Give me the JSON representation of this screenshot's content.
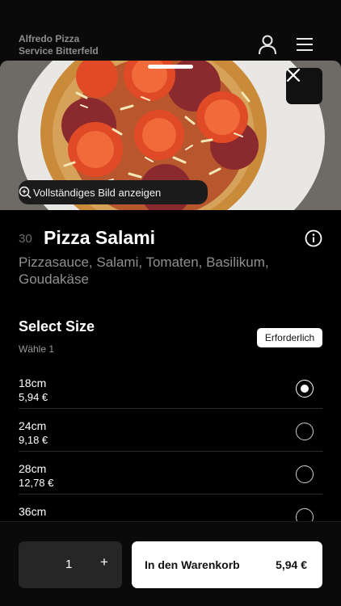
{
  "header": {
    "brand_line1": "Alfredo Pizza",
    "brand_line2": "Service Bitterfeld",
    "icons": [
      "user-icon",
      "menu-icon"
    ]
  },
  "image": {
    "view_full_label": "Vollständiges Bild anzeigen",
    "icons": [
      "close-icon",
      "zoom-icon"
    ]
  },
  "dish": {
    "number": "30",
    "name": "Pizza Salami",
    "description": "Pizzasauce, Salami, Tomaten, Basilikum, Goudakäse"
  },
  "size_section": {
    "title": "Select Size",
    "subtitle": "Wähle 1",
    "badge": "Erforderlich",
    "options": [
      {
        "name": "18cm",
        "price": "5,94 €",
        "selected": true
      },
      {
        "name": "24cm",
        "price": "9,18 €",
        "selected": false
      },
      {
        "name": "28cm",
        "price": "12,78 €",
        "selected": false
      },
      {
        "name": "36cm",
        "price": "",
        "selected": false
      }
    ]
  },
  "footer": {
    "quantity": "1",
    "plus_label": "+",
    "cart_label": "In den Warenkorb",
    "cart_price": "5,94 €"
  },
  "colors": {
    "background": "#000000",
    "accent": "#ffffff",
    "muted_text": "#909090"
  }
}
